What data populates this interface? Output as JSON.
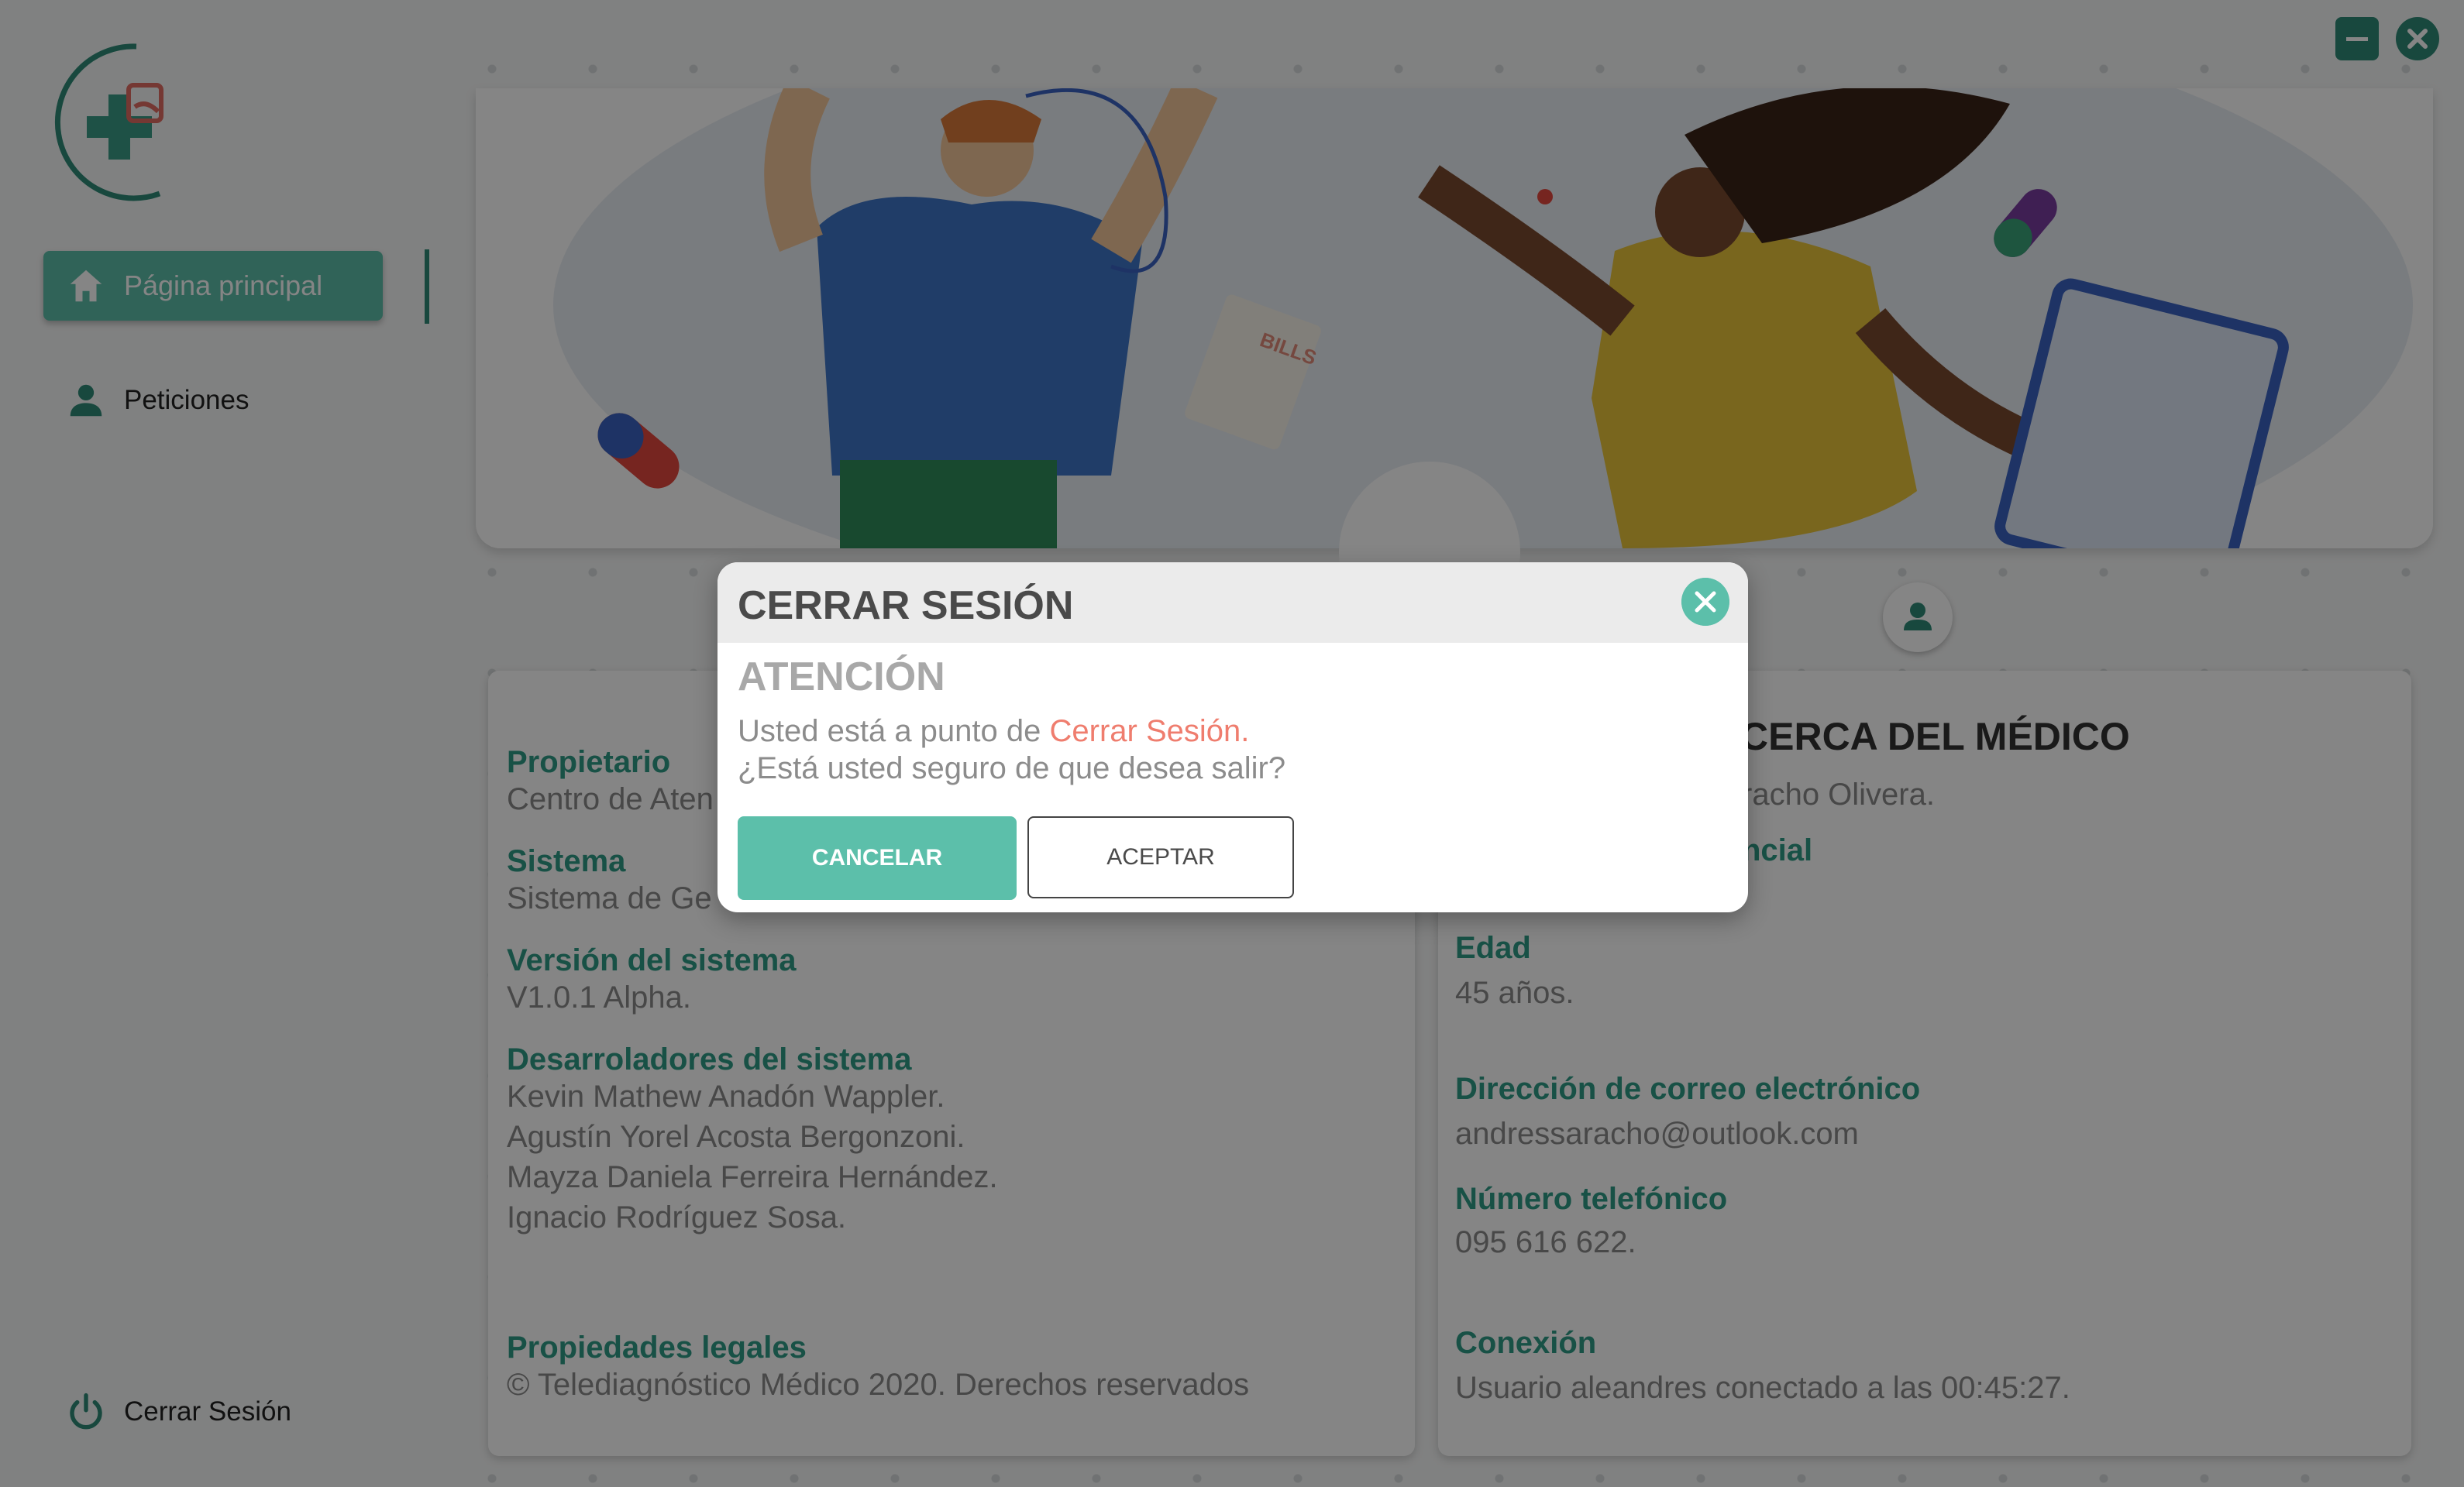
{
  "window": {
    "minimize_icon": "minimize-icon",
    "close_icon": "close-icon"
  },
  "colors": {
    "accent": "#5cbfaa",
    "accent_dark": "#2f9b86",
    "highlight": "#ef7d6e"
  },
  "sidebar": {
    "items": [
      {
        "label": "Página principal",
        "icon": "home-icon",
        "active": true
      },
      {
        "label": "Peticiones",
        "icon": "person-icon",
        "active": false
      }
    ],
    "logout_label": "Cerrar Sesión",
    "logout_icon": "power-icon"
  },
  "system_card": {
    "fields": [
      {
        "label": "Propietario",
        "value": "Centro de Aten"
      },
      {
        "label": "Sistema",
        "value": "Sistema de Ge"
      },
      {
        "label": "Versión del sistema",
        "value": "V1.0.1 Alpha."
      },
      {
        "label": "Desarroladores del sistema",
        "values": [
          "Kevin Mathew Anadón Wappler.",
          "Agustín Yorel Acosta Bergonzoni.",
          "Mayza Daniela Ferreira Hernández.",
          "Ignacio Rodríguez Sosa."
        ]
      },
      {
        "label": "Propiedades legales",
        "value": "© Telediagnóstico Médico 2020. Derechos reservados"
      }
    ]
  },
  "doctor_card": {
    "title": "CERCA DEL MÉDICO",
    "name_partial": "racho Olivera.",
    "specialty_label_partial": "ncial",
    "fields": [
      {
        "label": "Edad",
        "value": "45 años."
      },
      {
        "label": "Dirección de correo electrónico",
        "value": "andressaracho@outlook.com"
      },
      {
        "label": "Número telefónico",
        "value": "095 616 622."
      },
      {
        "label": "Conexión",
        "value": "Usuario aleandres conectado a las 00:45:27."
      }
    ]
  },
  "modal": {
    "title": "CERRAR SESIÓN",
    "subtitle": "ATENCIÓN",
    "line1_prefix": "Usted está a punto de ",
    "line1_highlight": "Cerrar Sesión",
    "line1_suffix": ".",
    "line2": "¿Está usted seguro de que desea salir?",
    "cancel_label": "CANCELAR",
    "accept_label": "ACEPTAR"
  }
}
